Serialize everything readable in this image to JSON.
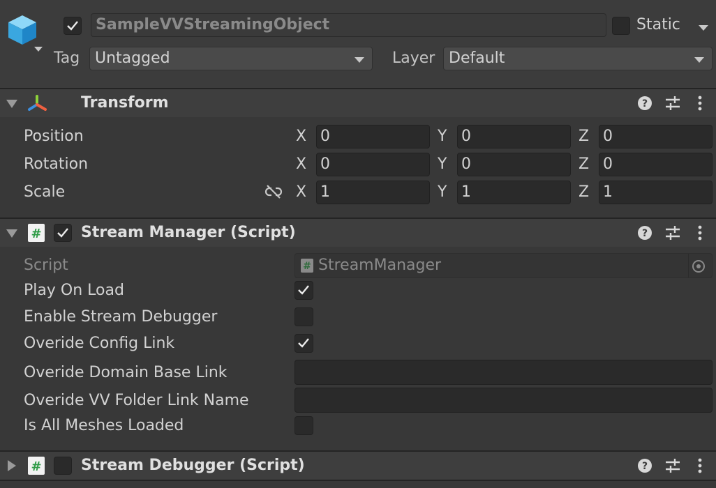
{
  "gameobject": {
    "active": true,
    "name": "SampleVVStreamingObject",
    "static_label": "Static",
    "static_checked": false,
    "tag_label": "Tag",
    "tag_value": "Untagged",
    "layer_label": "Layer",
    "layer_value": "Default"
  },
  "transform": {
    "title": "Transform",
    "rows": [
      {
        "label": "Position",
        "x": "0",
        "y": "0",
        "z": "0"
      },
      {
        "label": "Rotation",
        "x": "0",
        "y": "0",
        "z": "0"
      },
      {
        "label": "Scale",
        "x": "1",
        "y": "1",
        "z": "1"
      }
    ],
    "axis": {
      "x": "X",
      "y": "Y",
      "z": "Z"
    }
  },
  "stream_manager": {
    "title": "Stream Manager (Script)",
    "enabled": true,
    "script_label": "Script",
    "script_value": "StreamManager",
    "props": [
      {
        "label": "Play On Load",
        "type": "bool",
        "checked": true
      },
      {
        "label": "Enable Stream Debugger",
        "type": "bool",
        "checked": false
      },
      {
        "label": "Overide Config Link",
        "type": "bool",
        "checked": true
      },
      {
        "label": "Overide Domain Base Link",
        "type": "text",
        "value": ""
      },
      {
        "label": "Overide VV Folder Link Name",
        "type": "text",
        "value": ""
      },
      {
        "label": "Is All Meshes Loaded",
        "type": "bool",
        "checked": false
      }
    ]
  },
  "stream_debugger": {
    "title": "Stream Debugger (Script)",
    "enabled": false
  },
  "icons": {
    "header": [
      "help-icon",
      "presets-icon",
      "more-icon"
    ],
    "script": "cs-script-icon",
    "transform": "transform-axes-icon",
    "gameobject": "gameobject-cube-icon"
  },
  "colors": {
    "background": "#383838",
    "field": "#2a2a2a",
    "header": "#3e3e3e",
    "text": "#d2d2d2"
  }
}
